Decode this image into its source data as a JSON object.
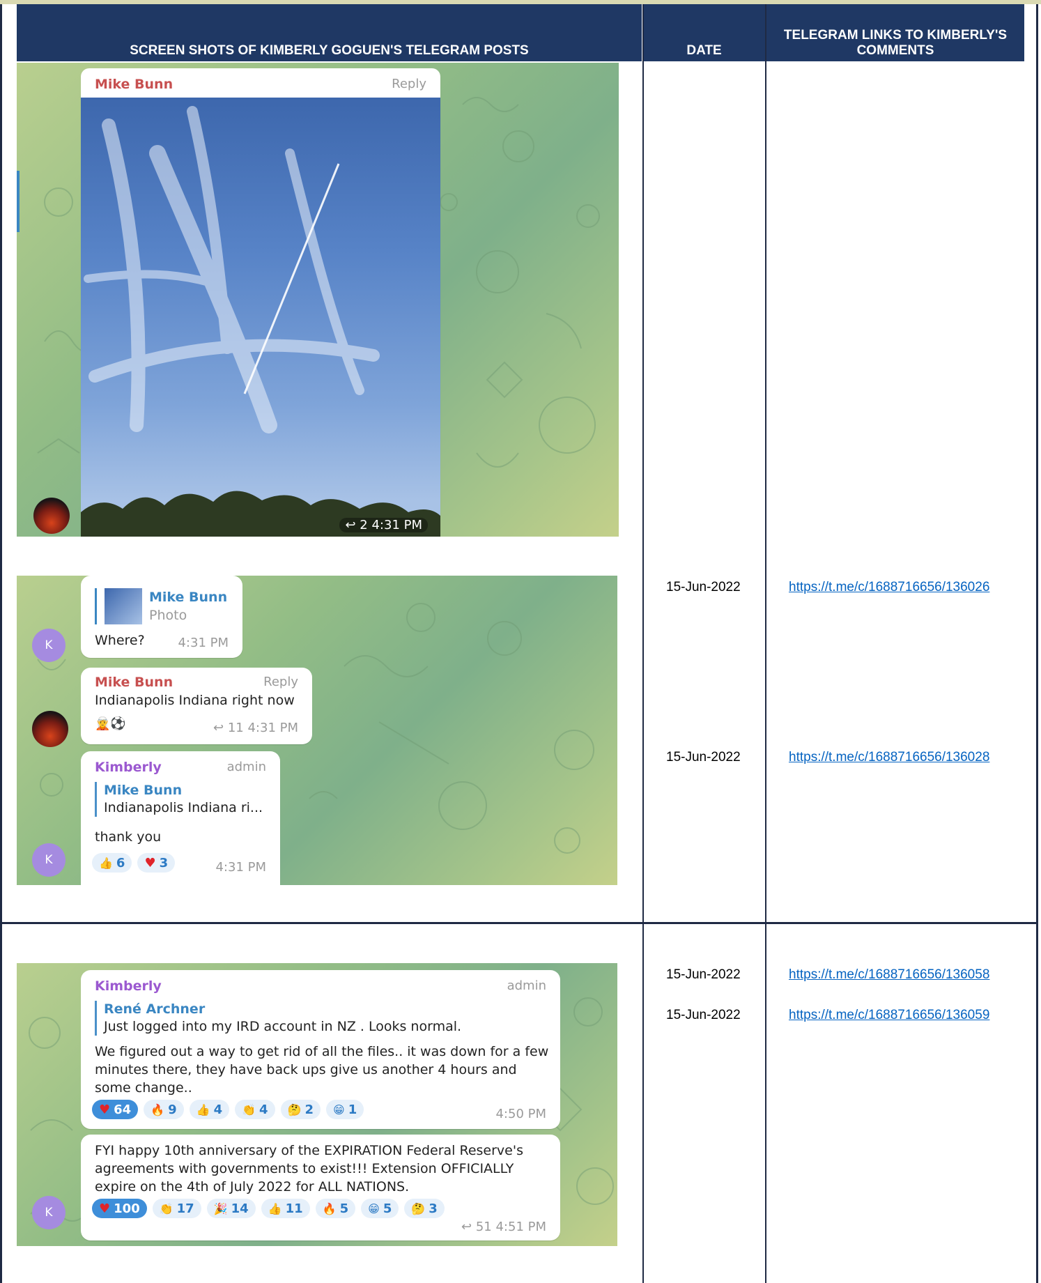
{
  "table": {
    "headers": {
      "col1": "SCREEN SHOTS OF KIMBERLY GOGUEN'S TELEGRAM POSTS",
      "col2": "DATE",
      "col3": "TELEGRAM LINKS TO KIMBERLY'S COMMENTS"
    },
    "rows": [
      {
        "entries": [
          {
            "date": "15-Jun-2022",
            "link": "https://t.me/c/1688716656/136026"
          },
          {
            "date": "15-Jun-2022",
            "link": "https://t.me/c/1688716656/136028"
          }
        ]
      },
      {
        "entries": [
          {
            "date": "15-Jun-2022",
            "link": "https://t.me/c/1688716656/136058"
          },
          {
            "date": "15-Jun-2022",
            "link": "https://t.me/c/1688716656/136059"
          }
        ]
      }
    ]
  },
  "shot1": {
    "sender": "Mike Bunn",
    "reply_label": "Reply",
    "forward_count": "2",
    "time": "4:31 PM"
  },
  "shot2": {
    "msg1": {
      "quote_name": "Mike Bunn",
      "quote_text": "Photo",
      "text": "Where?",
      "time": "4:31 PM",
      "avatar": "K"
    },
    "msg2": {
      "sender": "Mike Bunn",
      "reply_label": "Reply",
      "text": "Indianapolis Indiana right now",
      "forward_count": "11",
      "time": "4:31 PM"
    },
    "msg3": {
      "sender": "Kimberly",
      "role": "admin",
      "quote_name": "Mike Bunn",
      "quote_text": "Indianapolis Indiana ri...",
      "text": "thank you",
      "reactions": [
        {
          "icon": "thumbs-up",
          "glyph": "👍",
          "count": "6"
        },
        {
          "icon": "heart",
          "glyph": "♥",
          "count": "3"
        }
      ],
      "time": "4:31 PM",
      "avatar": "K"
    }
  },
  "shot3": {
    "msg1": {
      "sender": "Kimberly",
      "role": "admin",
      "quote_name": "René Archner",
      "quote_text": "Just logged into my IRD account in NZ . Looks normal.",
      "text_lines": [
        "We figured out a way to get rid of all the files.. it was down for a few",
        "minutes there, they have back ups give us another 4 hours and",
        "some change.."
      ],
      "reactions": [
        {
          "icon": "heart",
          "glyph": "♥",
          "count": "64",
          "selected": true
        },
        {
          "icon": "fire",
          "glyph": "🔥",
          "count": "9"
        },
        {
          "icon": "thumbs-up",
          "glyph": "👍",
          "count": "4"
        },
        {
          "icon": "clap",
          "glyph": "👏",
          "count": "4"
        },
        {
          "icon": "thinking",
          "glyph": "🤔",
          "count": "2"
        },
        {
          "icon": "grin",
          "glyph": "😁",
          "count": "1"
        }
      ],
      "time": "4:50 PM"
    },
    "msg2": {
      "text_lines": [
        "FYI happy 10th anniversary of the EXPIRATION Federal  Reserve's",
        "agreements with governments to exist!!! Extension OFFICIALLY",
        "expire on the 4th of July 2022 for ALL NATIONS."
      ],
      "reactions": [
        {
          "icon": "heart",
          "glyph": "♥",
          "count": "100",
          "selected": true
        },
        {
          "icon": "clap",
          "glyph": "👏",
          "count": "17"
        },
        {
          "icon": "party",
          "glyph": "🎉",
          "count": "14"
        },
        {
          "icon": "thumbs-up",
          "glyph": "👍",
          "count": "11"
        },
        {
          "icon": "fire",
          "glyph": "🔥",
          "count": "5"
        },
        {
          "icon": "grin",
          "glyph": "😁",
          "count": "5"
        },
        {
          "icon": "thinking",
          "glyph": "🤔",
          "count": "3"
        }
      ],
      "forward_count": "51",
      "time": "4:51 PM",
      "avatar": "K"
    }
  }
}
